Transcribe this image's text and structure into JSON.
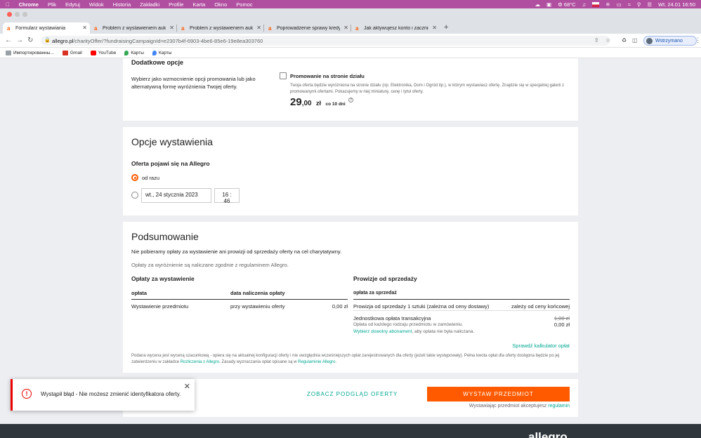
{
  "menubar": {
    "app": "Chrome",
    "items": [
      "Plik",
      "Edytuj",
      "Widok",
      "Historia",
      "Zakładki",
      "Profile",
      "Karta",
      "Okno",
      "Pomoc"
    ],
    "temp": "68°C",
    "clock": "Wt. 24.01  16:50"
  },
  "tabs": [
    {
      "label": "Formularz wystawiania",
      "favicon": "a",
      "active": true
    },
    {
      "label": "Problem z wystawieniem aukcji",
      "favicon": "a",
      "active": false
    },
    {
      "label": "Problem z wystawieniem aukcji",
      "favicon": "a",
      "active": false
    },
    {
      "label": "Poprowadzenie sprawy kredytowej",
      "favicon": "a",
      "active": false
    },
    {
      "label": "Jak aktywujesz konto i zacznie",
      "favicon": "a",
      "active": false
    }
  ],
  "address": {
    "host": "allegro.pl",
    "path": "/charityOffer/?fundraisingCampaignId=e2307b4f-6903-4be6-85e6-19e8ea303760",
    "profile": "Wstrzymano"
  },
  "bookmarks": [
    {
      "label": "Импортированны...",
      "icon": "folder-icon",
      "color": "#9aa0a6"
    },
    {
      "label": "Gmail",
      "icon": "gmail-icon",
      "color": "#d93025"
    },
    {
      "label": "YouTube",
      "icon": "youtube-icon",
      "color": "#ff0000"
    },
    {
      "label": "Карты",
      "icon": "maps-icon",
      "color": "#34a853"
    },
    {
      "label": "Карты",
      "icon": "maps-icon",
      "color": "#4285f4"
    }
  ],
  "dodatkowe": {
    "title": "Dodatkowe opcje",
    "desc": "Wybierz jako wzmocnienie opcji promowania lub jako alternatywną formę wyróżnienia Twojej oferty.",
    "option_label": "Promowanie na stronie działu",
    "option_desc": "Twoja oferta będzie wyróżniona na stronie działu (np. Elektronika, Dom i Ogród itp.), w którym wystawiasz ofertę. Znajdzie się w specjalnej galerii z promowanymi ofertami. Pokazujemy w niej miniaturę, cenę i tytuł oferty.",
    "price_int": "29",
    "price_dec": ",00",
    "currency": "zł",
    "period": "co 10 dni"
  },
  "opcje": {
    "title": "Opcje wystawienia",
    "subtitle": "Oferta pojawi się na Allegro",
    "radio_now": "od razu",
    "date_value": "wt., 24 stycznia 2023",
    "time_value": "16 : 46"
  },
  "podsumowanie": {
    "title": "Podsumowanie",
    "note1": "Nie pobieramy opłaty za wystawienie ani prowizji od sprzedaży oferty na cel charytatywny.",
    "note2": "Opłaty za wyróżnienie są naliczane zgodnie z regulaminem Allegro.",
    "left_title": "Opłaty za wystawienie",
    "left_headers": [
      "opłata",
      "data naliczenia opłaty"
    ],
    "left_row": [
      "Wystawienie przedmiotu",
      "przy wystawieniu oferty",
      "0,00 zł"
    ],
    "right_title": "Prowizje od sprzedaży",
    "right_header": "opłata za sprzedaż",
    "right_row1": [
      "Prowizja od sprzedaży 1 sztuki (zależna od ceny dostawy)",
      "zależy od ceny końcowej"
    ],
    "right_row2_label": "Jednostkowa opłata transakcyjna",
    "right_row2_old": "1,00 zł",
    "right_row2_new": "0,00 zł",
    "right_row2_desc": "Opłata od każdego rodzaju przedmiotu w zamówieniu.",
    "right_row2_link": "Wybierz dowolny abonament",
    "right_row2_link_rest": ", aby opłata nie była naliczana.",
    "calc_link": "Sprawdź kalkulator opłat",
    "disclaimer_a": "Podana wycena jest wyceną szacunkową - opiera się na aktualnej konfiguracji oferty i nie uwzględnia wcześniejszych opłat zarejestrowanych dla oferty (jeżeli takie występowały). Pełna kwota opłat dla oferty dostępna będzie po jej zatwierdzeniu w zakładce ",
    "disclaimer_link1": "Rozliczenia z Allegro",
    "disclaimer_b": ". Zasady wyznaczania opłat opisane są w ",
    "disclaimer_link2": "Regulaminie Allegro",
    "disclaimer_c": "."
  },
  "actions": {
    "preview": "ZOBACZ PODGLĄD OFERTY",
    "submit": "WYSTAW PRZEDMIOT",
    "accept_text": "Wystawiając przedmiot akceptujesz ",
    "accept_link": "regulamin"
  },
  "toast": {
    "message": "Wystąpił błąd - Nie możesz zmienić identyfikatora oferty."
  },
  "footer": {
    "logo": "allegro"
  },
  "colors": {
    "accent": "#ff5a00",
    "link": "#00a790",
    "error": "#e00000"
  }
}
